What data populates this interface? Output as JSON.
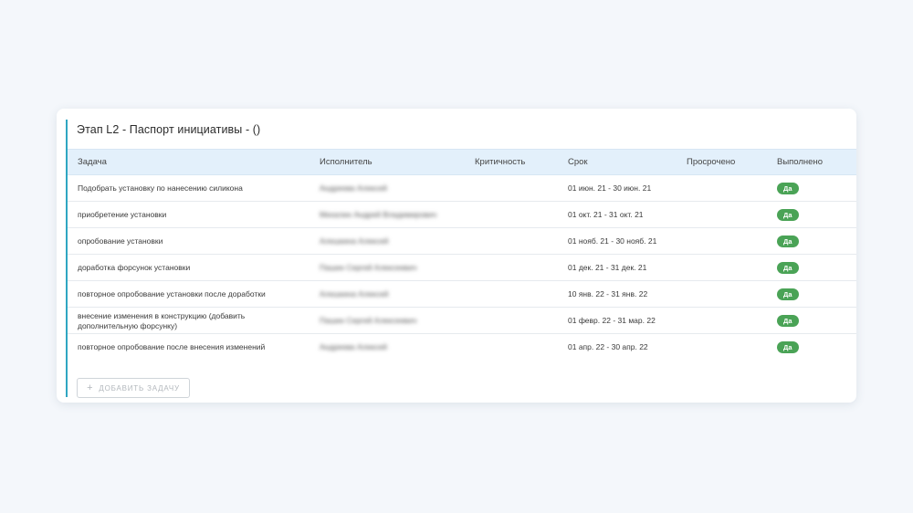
{
  "card": {
    "title": "Этап L2 - Паспорт инициативы - ()"
  },
  "table": {
    "headers": {
      "task": "Задача",
      "executor": "Исполнитель",
      "criticality": "Критичность",
      "term": "Срок",
      "overdue": "Просрочено",
      "done": "Выполнено"
    },
    "rows": [
      {
        "task": "Подобрать установку по нанесению силикона",
        "executor": "Андреева Алексей",
        "criticality": "",
        "term": "01 июн. 21 - 30 июн. 21",
        "overdue": "",
        "done": "Да"
      },
      {
        "task": "приобретение установки",
        "executor": "Михалин Андрей Владимирович",
        "criticality": "",
        "term": "01 окт. 21 - 31 окт. 21",
        "overdue": "",
        "done": "Да"
      },
      {
        "task": "опробование установки",
        "executor": "Алешкина Алексей",
        "criticality": "",
        "term": "01 нояб. 21 - 30 нояб. 21",
        "overdue": "",
        "done": "Да"
      },
      {
        "task": "доработка форсунок установки",
        "executor": "Пашин Сергей Алексеевич",
        "criticality": "",
        "term": "01 дек. 21 - 31 дек. 21",
        "overdue": "",
        "done": "Да"
      },
      {
        "task": "повторное опробование установки после доработки",
        "executor": "Алешкина Алексей",
        "criticality": "",
        "term": "10 янв. 22 - 31 янв. 22",
        "overdue": "",
        "done": "Да"
      },
      {
        "task": "внесение изменения в конструкцию (добавить дополнительную форсунку)",
        "executor": "Пашин Сергей Алексеевич",
        "criticality": "",
        "term": "01 февр. 22 - 31 мар. 22",
        "overdue": "",
        "done": "Да"
      },
      {
        "task": "повторное опробование после внесения изменений",
        "executor": "Андреева Алексей",
        "criticality": "",
        "term": "01 апр. 22 - 30 апр. 22",
        "overdue": "",
        "done": "Да"
      }
    ]
  },
  "add_button": {
    "icon": "plus-icon",
    "label": "ДОБАВИТЬ ЗАДАЧУ"
  },
  "colors": {
    "accent": "#2fa6c2",
    "header_bg": "#e3f0fb",
    "badge_green": "#4aa356",
    "page_bg": "#f4f7fb"
  }
}
